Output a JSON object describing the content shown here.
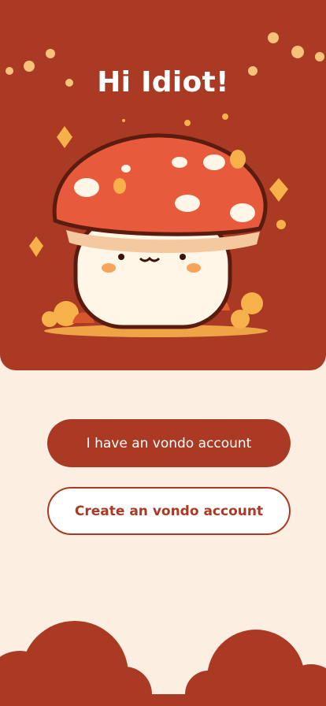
{
  "header": {
    "greeting": "Hi Idiot!"
  },
  "mascot": {
    "icon": "mushroom-mascot-icon"
  },
  "auth": {
    "login_label": "I have an vondo account",
    "create_label": "Create an vondo account"
  },
  "colors": {
    "brand": "#ab3a24",
    "background": "#fcefe2",
    "cap": "#e85a3c",
    "leaf": "#f6b14a",
    "body": "#fff6e8"
  }
}
